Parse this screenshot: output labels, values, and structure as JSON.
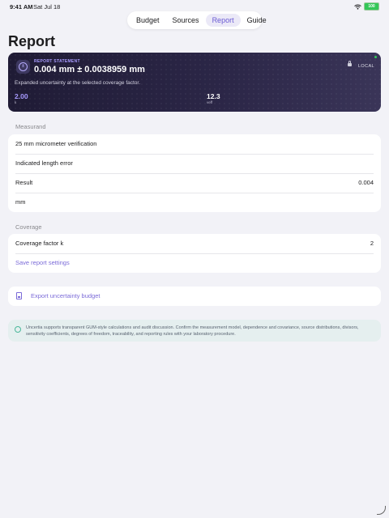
{
  "status": {
    "time": "9:41 AM",
    "date": "Sat Jul 18",
    "battery": "100"
  },
  "tabs": [
    {
      "label": "Budget"
    },
    {
      "label": "Sources"
    },
    {
      "label": "Report",
      "active": true
    },
    {
      "label": "Guide"
    }
  ],
  "page_title": "Report",
  "statement": {
    "label": "REPORT STATEMENT",
    "value": "0.004 mm ± 0.0038959 mm",
    "description": "Expanded uncertainty at the selected coverage factor.",
    "local_badge": "LOCAL",
    "k_value": "2.00",
    "k_label": "k",
    "veff_value": "12.3",
    "veff_label": "veff",
    "icon": "uncertainty-icon"
  },
  "measurand": {
    "header": "Measurand",
    "name": "25 mm micrometer verification",
    "quantity": "Indicated length error",
    "result_label": "Result",
    "result_value": "0.004",
    "unit": "mm"
  },
  "coverage": {
    "header": "Coverage",
    "factor_label": "Coverage factor k",
    "factor_value": "2",
    "save_label": "Save report settings"
  },
  "export": {
    "label": "Export uncertainty budget",
    "icon": "csv-document-icon"
  },
  "info": {
    "text": "Uncertia supports transparent GUM-style calculations and audit discussion. Confirm the measurement model, dependence and covariance, source distributions, divisors, sensitivity coefficients, degrees of freedom, traceability, and reporting rules with your laboratory procedure.",
    "icon": "badge-icon"
  },
  "colors": {
    "accent": "#7b6bd8",
    "hero_bg": "#262240",
    "info_bg": "#e5efef",
    "background": "#f2f2f7"
  }
}
